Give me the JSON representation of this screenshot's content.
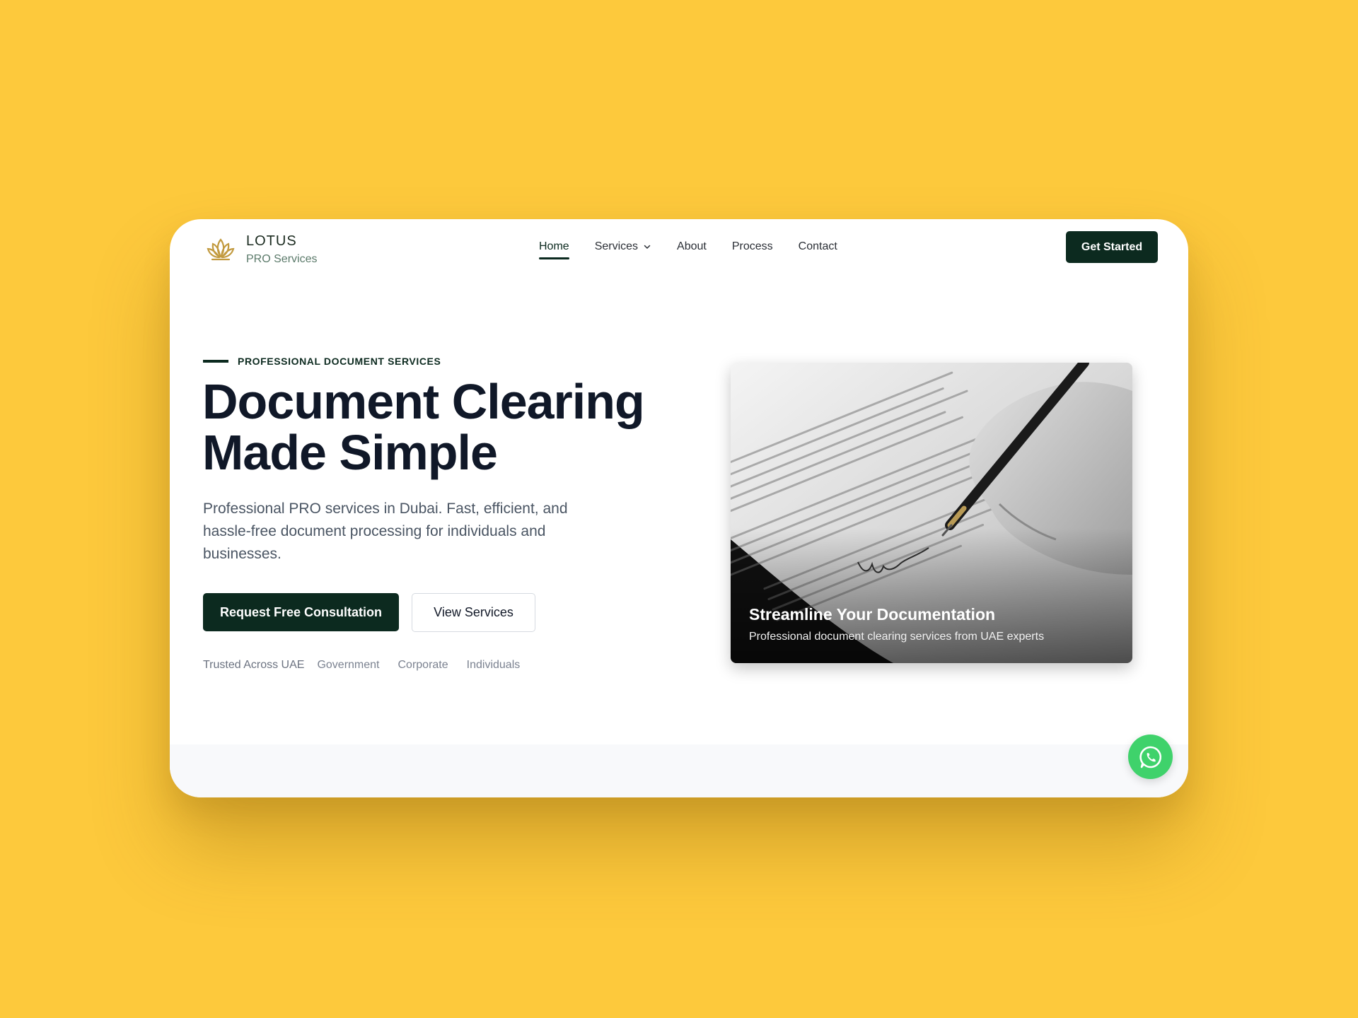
{
  "brand": {
    "name": "LOTUS",
    "tagline": "PRO Services",
    "logo_icon": "lotus-icon",
    "accent_color": "#C29A3F"
  },
  "nav": {
    "items": [
      {
        "label": "Home",
        "active": true
      },
      {
        "label": "Services",
        "has_dropdown": true
      },
      {
        "label": "About"
      },
      {
        "label": "Process"
      },
      {
        "label": "Contact"
      }
    ],
    "cta_label": "Get Started"
  },
  "hero": {
    "eyebrow": "PROFESSIONAL DOCUMENT SERVICES",
    "headline_line1": "Document Clearing",
    "headline_line2": "Made Simple",
    "subtext": "Professional PRO services in Dubai. Fast, efficient, and hassle-free document processing for individuals and businesses.",
    "primary_button": "Request Free Consultation",
    "secondary_button": "View Services",
    "trusted_label": "Trusted Across UAE",
    "trusted_items": [
      "Government",
      "Corporate",
      "Individuals"
    ]
  },
  "hero_image": {
    "title": "Streamline Your Documentation",
    "subtitle": "Professional document clearing services from UAE experts"
  },
  "floating": {
    "icon": "whatsapp-icon"
  },
  "colors": {
    "background": "#FDC93C",
    "primary": "#0C2A1F",
    "whatsapp": "#3FD26B"
  }
}
